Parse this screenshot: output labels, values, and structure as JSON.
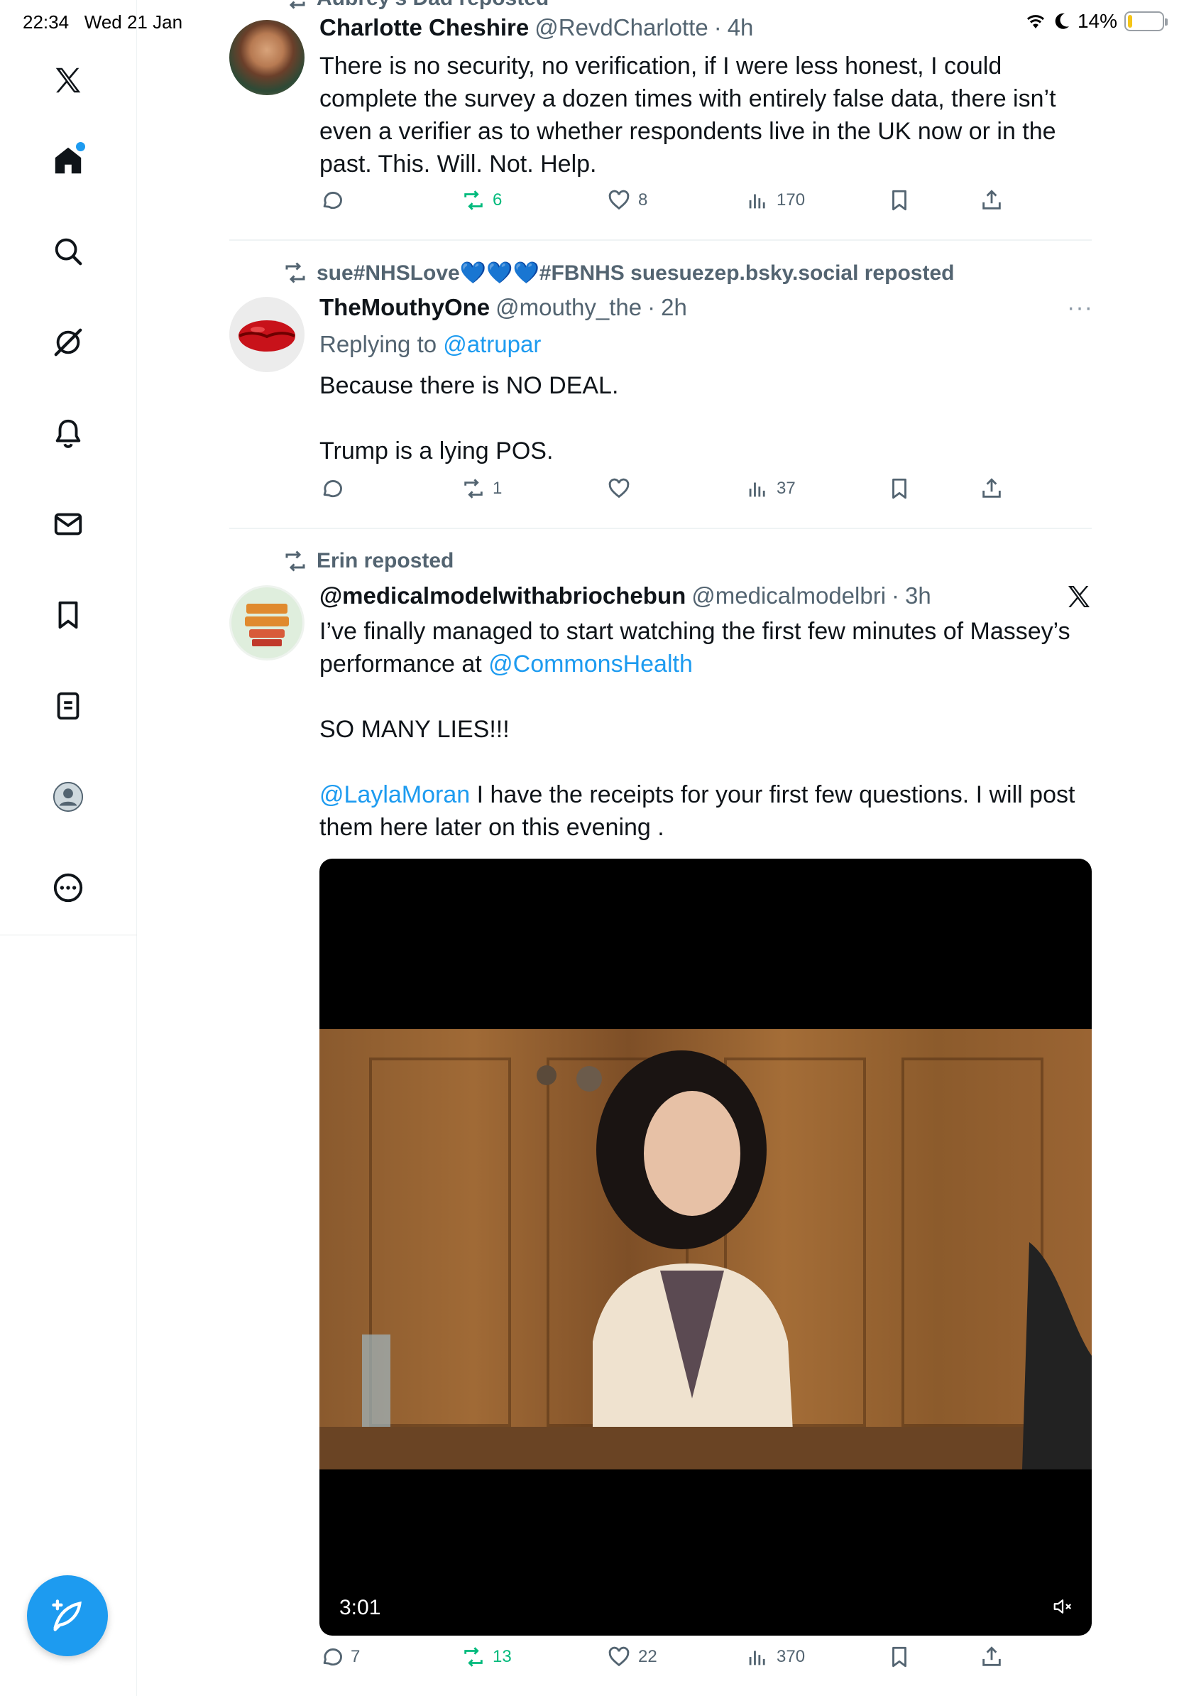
{
  "status_bar": {
    "time": "22:34",
    "date": "Wed 21 Jan",
    "battery": "14%",
    "battery_level": 0.14
  },
  "sidebar": {
    "items": [
      {
        "icon": "x-logo-icon"
      },
      {
        "icon": "home-icon",
        "notification_dot": true
      },
      {
        "icon": "search-icon"
      },
      {
        "icon": "grok-icon"
      },
      {
        "icon": "bell-icon"
      },
      {
        "icon": "mail-icon"
      },
      {
        "icon": "bookmark-icon"
      },
      {
        "icon": "lists-icon"
      },
      {
        "icon": "profile-icon"
      },
      {
        "icon": "more-icon"
      }
    ],
    "compose_icon": "compose-icon"
  },
  "posts": [
    {
      "repost_label": "Aubrey's Dad reposted",
      "name": "Charlotte Cheshire",
      "handle": "@RevdCharlotte",
      "time": "4h",
      "text": "There is no security, no verification, if I were less honest, I could complete the survey a dozen times with entirely false data, there isn’t even a verifier as to whether respondents live in the UK now or in the past. This. Will. Not. Help.",
      "replies": "",
      "reposts": "6",
      "likes": "8",
      "views": "170"
    },
    {
      "repost_label": "sue#NHSLove💙💙💙#FBNHS suesuezep.bsky.social reposted",
      "name": "TheMouthyOne",
      "handle": "@mouthy_the",
      "time": "2h",
      "replying_prefix": "Replying to ",
      "replying_to": "@atrupar",
      "text_1": "Because there is NO DEAL.",
      "text_2": "Trump is a lying POS.",
      "more": "···",
      "replies": "",
      "reposts": "1",
      "likes": "",
      "views": "37"
    },
    {
      "repost_label": "Erin reposted",
      "name": "@medicalmodelwithabriochebun",
      "handle": "@medicalmodelbri",
      "time": "3h",
      "text_1_a": "I’ve finally managed to start watching the first few minutes of Massey’s performance at ",
      "text_1_mention": "@CommonsHealth",
      "text_2": "SO MANY LIES!!!",
      "text_3_mention": "@LaylaMoran",
      "text_3_b": " I have the receipts for your first few questions. I will post them here later on this evening .",
      "video_duration": "3:01",
      "replies": "7",
      "reposts": "13",
      "likes": "22",
      "views": "370"
    }
  ],
  "colors": {
    "accent": "#1d9bf0",
    "repost_green": "#00ba7c",
    "secondary_text": "#536471"
  }
}
